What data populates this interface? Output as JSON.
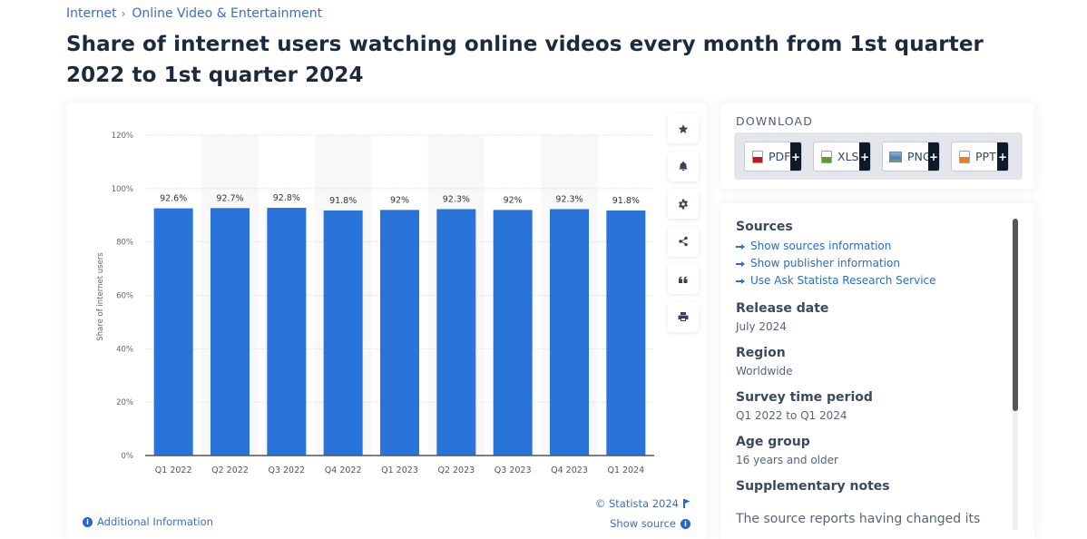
{
  "breadcrumb": {
    "items": [
      "Internet",
      "Online Video & Entertainment"
    ],
    "separator": "›"
  },
  "page": {
    "title": "Share of internet users watching online videos every month from 1st quarter 2022 to 1st quarter 2024"
  },
  "toolbar": {
    "icons": [
      "star-icon",
      "bell-icon",
      "gear-icon",
      "share-icon",
      "quote-icon",
      "print-icon"
    ]
  },
  "chart_footer": {
    "additional_info": "Additional Information",
    "copyright": "© Statista 2024",
    "show_source": "Show source"
  },
  "download": {
    "title": "DOWNLOAD",
    "buttons": [
      {
        "label": "PDF",
        "icon": "pdf-file-icon",
        "color": "#c4161c"
      },
      {
        "label": "XLS",
        "icon": "xls-file-icon",
        "color": "#5a9e2e"
      },
      {
        "label": "PNG",
        "icon": "png-file-icon",
        "color": "#4d7fb8"
      },
      {
        "label": "PPT",
        "icon": "ppt-file-icon",
        "color": "#e77e23"
      }
    ],
    "plus": "+"
  },
  "info": {
    "sources_heading": "Sources",
    "links": [
      "Show sources information",
      "Show publisher information",
      "Use Ask Statista Research Service"
    ],
    "release_date_heading": "Release date",
    "release_date": "July 2024",
    "region_heading": "Region",
    "region": "Worldwide",
    "survey_heading": "Survey time period",
    "survey": "Q1 2022 to Q1 2024",
    "age_heading": "Age group",
    "age": "16 years and older",
    "notes_heading": "Supplementary notes",
    "notes_text": "The source reports having changed its"
  },
  "colors": {
    "bar": "#2a74d9",
    "link": "#3b6cc9",
    "title": "#1b2a3c"
  },
  "chart_data": {
    "type": "bar",
    "title": "Share of internet users watching online videos every month from 1st quarter 2022 to 1st quarter 2024",
    "categories": [
      "Q1 2022",
      "Q2 2022",
      "Q3 2022",
      "Q4 2022",
      "Q1 2023",
      "Q2 2023",
      "Q3 2023",
      "Q4 2023",
      "Q1 2024"
    ],
    "values": [
      92.6,
      92.7,
      92.8,
      91.8,
      92,
      92.3,
      92,
      92.3,
      91.8
    ],
    "data_labels": [
      "92.6%",
      "92.7%",
      "92.8%",
      "91.8%",
      "92%",
      "92.3%",
      "92%",
      "92.3%",
      "91.8%"
    ],
    "xlabel": "",
    "ylabel": "Share of internet users",
    "ylim": [
      0,
      120
    ],
    "yticks": [
      0,
      20,
      40,
      60,
      80,
      100,
      120
    ],
    "ytick_labels": [
      "0%",
      "20%",
      "40%",
      "60%",
      "80%",
      "100%",
      "120%"
    ],
    "grid": true,
    "legend": "none"
  }
}
